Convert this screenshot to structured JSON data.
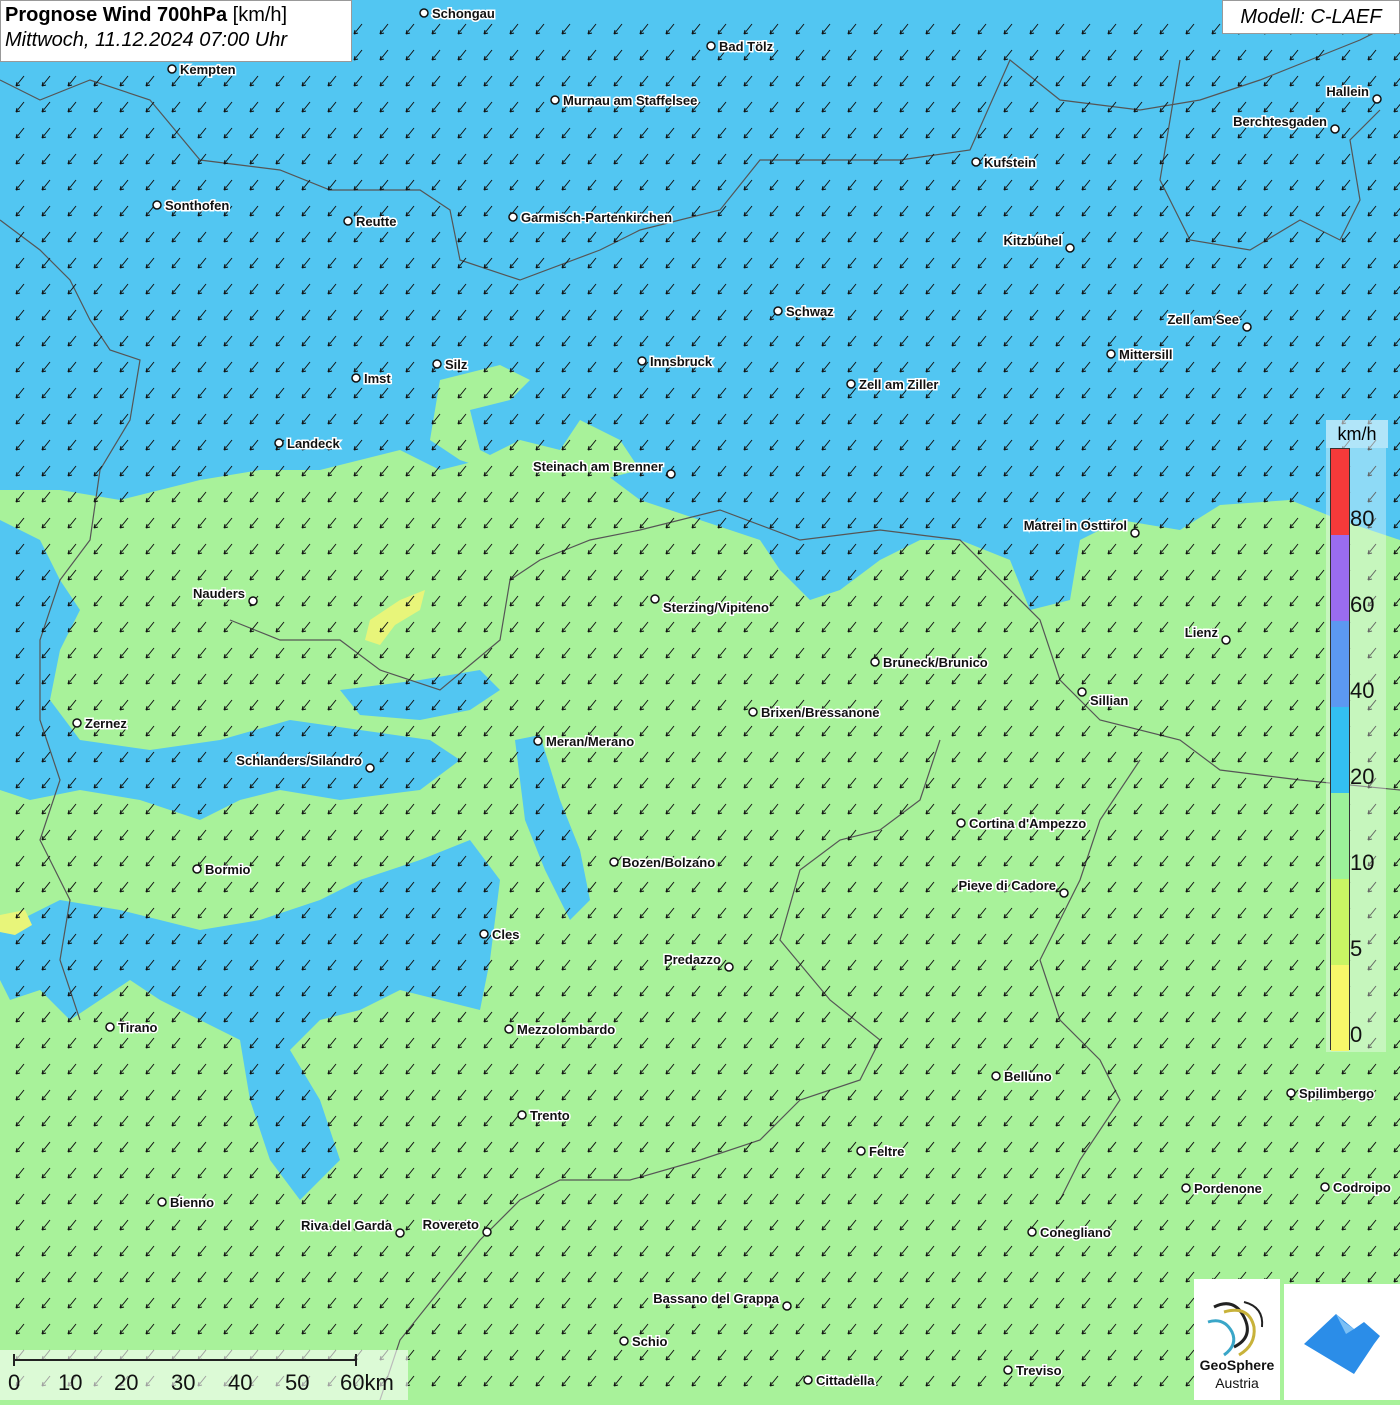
{
  "title": {
    "main": "Prognose Wind 700hPa",
    "unit": "[km/h]",
    "datetime": "Mittwoch, 11.12.2024 07:00 Uhr"
  },
  "model_label": "Modell: C-LAEF",
  "legend": {
    "unit": "km/h",
    "labels": [
      "80",
      "60",
      "40",
      "20",
      "10",
      "5",
      "0"
    ],
    "colors": [
      "#f53a3a",
      "#9a6cf0",
      "#5c98f2",
      "#33bff2",
      "#9cf29a",
      "#c8f564",
      "#f7f76a"
    ]
  },
  "scale_bar": {
    "labels": [
      "0",
      "10",
      "20",
      "30",
      "40",
      "50",
      "60km"
    ]
  },
  "logos": {
    "geosphere_line1": "GeoSphere",
    "geosphere_line2": "Austria"
  },
  "colors": {
    "zone_blue": "#52c6f2",
    "zone_green": "#a8f29a"
  },
  "cities": [
    {
      "name": "Schongau"
    },
    {
      "name": "Bad Tölz"
    },
    {
      "name": "Kempten"
    },
    {
      "name": "Murnau am Staffelsee"
    },
    {
      "name": "Hallein"
    },
    {
      "name": "Berchtesgaden"
    },
    {
      "name": "Kufstein"
    },
    {
      "name": "Sonthofen"
    },
    {
      "name": "Reutte"
    },
    {
      "name": "Garmisch-Partenkirchen"
    },
    {
      "name": "Kitzbühel"
    },
    {
      "name": "Schwaz"
    },
    {
      "name": "Zell am See"
    },
    {
      "name": "Mittersill"
    },
    {
      "name": "Imst"
    },
    {
      "name": "Silz"
    },
    {
      "name": "Innsbruck"
    },
    {
      "name": "Zell am Ziller"
    },
    {
      "name": "Landeck"
    },
    {
      "name": "Steinach am Brenner"
    },
    {
      "name": "Matrei in Osttirol"
    },
    {
      "name": "Nauders"
    },
    {
      "name": "Sterzing/Vipiteno"
    },
    {
      "name": "Lienz"
    },
    {
      "name": "Bruneck/Brunico"
    },
    {
      "name": "Sillian"
    },
    {
      "name": "Zernez"
    },
    {
      "name": "Brixen/Bressanone"
    },
    {
      "name": "Meran/Merano"
    },
    {
      "name": "Schlanders/Silandro"
    },
    {
      "name": "Cortina d'Ampezzo"
    },
    {
      "name": "Bozen/Bolzano"
    },
    {
      "name": "Bormio"
    },
    {
      "name": "Pieve di Cadore"
    },
    {
      "name": "Cles"
    },
    {
      "name": "Predazzo"
    },
    {
      "name": "Tirano"
    },
    {
      "name": "Mezzolombardo"
    },
    {
      "name": "Belluno"
    },
    {
      "name": "Spilimbergo"
    },
    {
      "name": "Trento"
    },
    {
      "name": "Feltre"
    },
    {
      "name": "Pordenone"
    },
    {
      "name": "Codroipo"
    },
    {
      "name": "Bienno"
    },
    {
      "name": "Riva del Garda"
    },
    {
      "name": "Rovereto"
    },
    {
      "name": "Conegliano"
    },
    {
      "name": "Bassano del Grappa"
    },
    {
      "name": "Schio"
    },
    {
      "name": "Treviso"
    },
    {
      "name": "Cittadella"
    }
  ]
}
